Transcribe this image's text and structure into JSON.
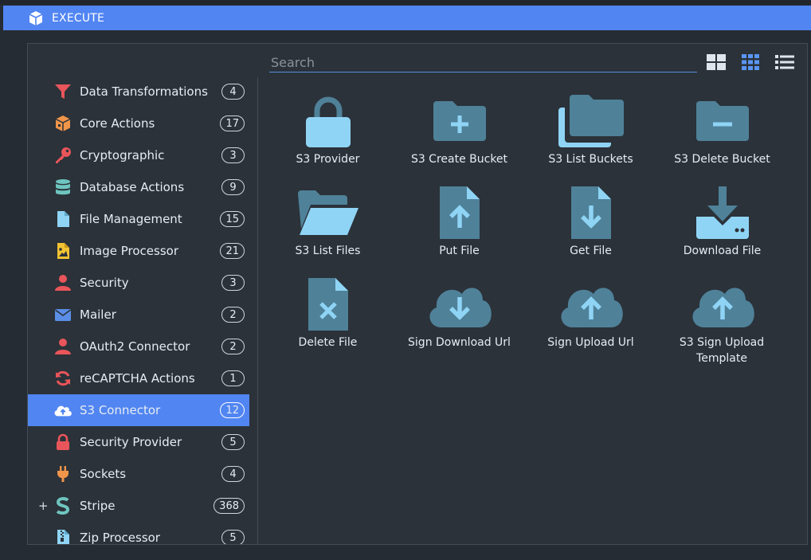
{
  "window": {
    "title": "EXECUTE",
    "icon": "cube-icon"
  },
  "search": {
    "placeholder": "Search"
  },
  "view_modes": [
    "large-grid-icon",
    "small-grid-icon",
    "list-icon"
  ],
  "sidebar": {
    "items": [
      {
        "label": "Data Transformations",
        "count": "4",
        "icon": "filter-icon"
      },
      {
        "label": "Core Actions",
        "count": "17",
        "icon": "box-icon"
      },
      {
        "label": "Cryptographic",
        "count": "3",
        "icon": "key-icon"
      },
      {
        "label": "Database Actions",
        "count": "9",
        "icon": "database-icon"
      },
      {
        "label": "File Management",
        "count": "15",
        "icon": "file-icon"
      },
      {
        "label": "Image Processor",
        "count": "21",
        "icon": "image-file-icon"
      },
      {
        "label": "Security",
        "count": "3",
        "icon": "user-icon"
      },
      {
        "label": "Mailer",
        "count": "2",
        "icon": "envelope-icon"
      },
      {
        "label": "OAuth2 Connector",
        "count": "2",
        "icon": "user-icon"
      },
      {
        "label": "reCAPTCHA Actions",
        "count": "1",
        "icon": "sync-icon"
      },
      {
        "label": "S3 Connector",
        "count": "12",
        "icon": "cloud-upload-icon",
        "active": true
      },
      {
        "label": "Security Provider",
        "count": "5",
        "icon": "lock-icon"
      },
      {
        "label": "Sockets",
        "count": "4",
        "icon": "plug-icon"
      },
      {
        "label": "Stripe",
        "count": "368",
        "icon": "stripe-icon",
        "expandable": "+"
      },
      {
        "label": "Zip Processor",
        "count": "5",
        "icon": "zip-file-icon"
      }
    ]
  },
  "actions": [
    {
      "label": "S3 Provider",
      "icon": "lock-icon"
    },
    {
      "label": "S3 Create Bucket",
      "icon": "folder-plus-icon"
    },
    {
      "label": "S3 List Buckets",
      "icon": "folders-icon"
    },
    {
      "label": "S3 Delete Bucket",
      "icon": "folder-minus-icon"
    },
    {
      "label": "S3 List Files",
      "icon": "folder-open-icon"
    },
    {
      "label": "Put File",
      "icon": "file-upload-icon"
    },
    {
      "label": "Get File",
      "icon": "file-download-icon"
    },
    {
      "label": "Download File",
      "icon": "download-icon"
    },
    {
      "label": "Delete File",
      "icon": "file-delete-icon"
    },
    {
      "label": "Sign Download Url",
      "icon": "cloud-download-icon"
    },
    {
      "label": "Sign Upload Url",
      "icon": "cloud-upload-icon"
    },
    {
      "label": "S3 Sign Upload Template",
      "icon": "cloud-upload-icon"
    }
  ],
  "colors": {
    "accent": "#5185f2",
    "panel_bg": "#2b3239",
    "icon_light": "#8fd4f5",
    "icon_dark": "#4f8199"
  }
}
